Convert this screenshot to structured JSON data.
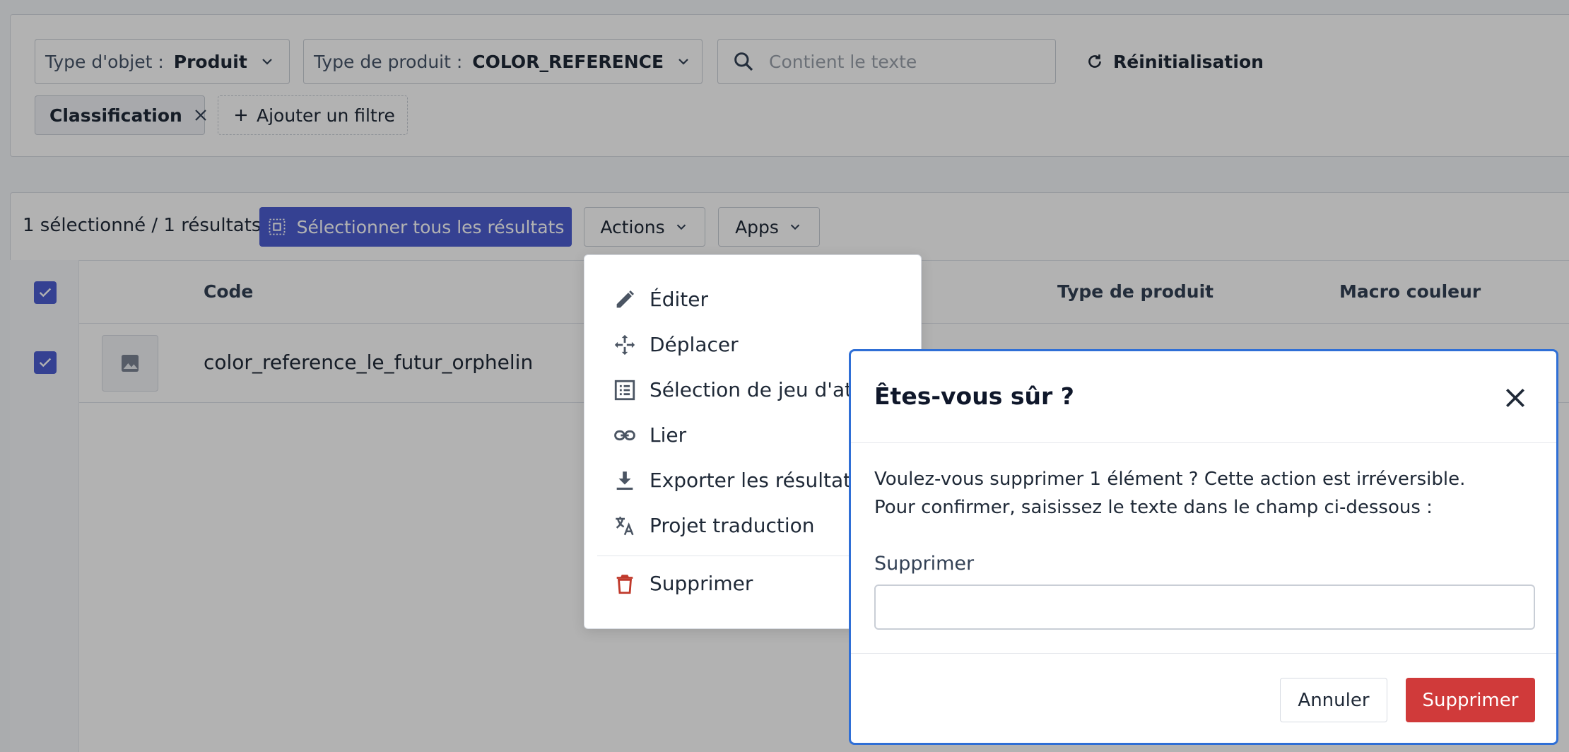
{
  "filters": {
    "object_type": {
      "label": "Type d'objet :",
      "value": "Produit"
    },
    "product_type": {
      "label": "Type de produit :",
      "value": "COLOR_REFERENCE"
    },
    "search": {
      "placeholder": "Contient le texte",
      "value": ""
    },
    "reset_label": "Réinitialisation",
    "classification_label": "Classification",
    "add_filter_label": "Ajouter un filtre"
  },
  "toolbar": {
    "selection_summary": "1 sélectionné / 1 résultats",
    "select_all_label": "Sélectionner tous les résultats",
    "actions_label": "Actions",
    "apps_label": "Apps"
  },
  "table": {
    "columns": [
      "Code",
      "Type de produit",
      "Macro couleur"
    ],
    "rows": [
      {
        "code": "color_reference_le_futur_orphelin",
        "checked": true
      }
    ]
  },
  "actions_menu": {
    "items": [
      {
        "label": "Éditer",
        "icon": "pencil-icon"
      },
      {
        "label": "Déplacer",
        "icon": "move-icon"
      },
      {
        "label": "Sélection de jeu d'attr",
        "icon": "list-icon"
      },
      {
        "label": "Lier",
        "icon": "link-icon"
      },
      {
        "label": "Exporter les résultats",
        "icon": "download-icon"
      },
      {
        "label": "Projet traduction",
        "icon": "translate-icon"
      },
      {
        "label": "Supprimer",
        "icon": "trash-icon",
        "color": "#c0392b"
      }
    ]
  },
  "modal": {
    "title": "Êtes-vous sûr ?",
    "message_line1": "Voulez-vous supprimer 1 élément ? Cette action est irréversible.",
    "message_line2": "Pour confirmer, saisissez le texte dans le champ ci-dessous :",
    "field_label": "Supprimer",
    "field_value": "",
    "cancel_label": "Annuler",
    "confirm_label": "Supprimer"
  },
  "colors": {
    "primary": "#4c5ed2",
    "danger": "#d03a3a",
    "modal_focus_border": "#2f6fd6"
  }
}
